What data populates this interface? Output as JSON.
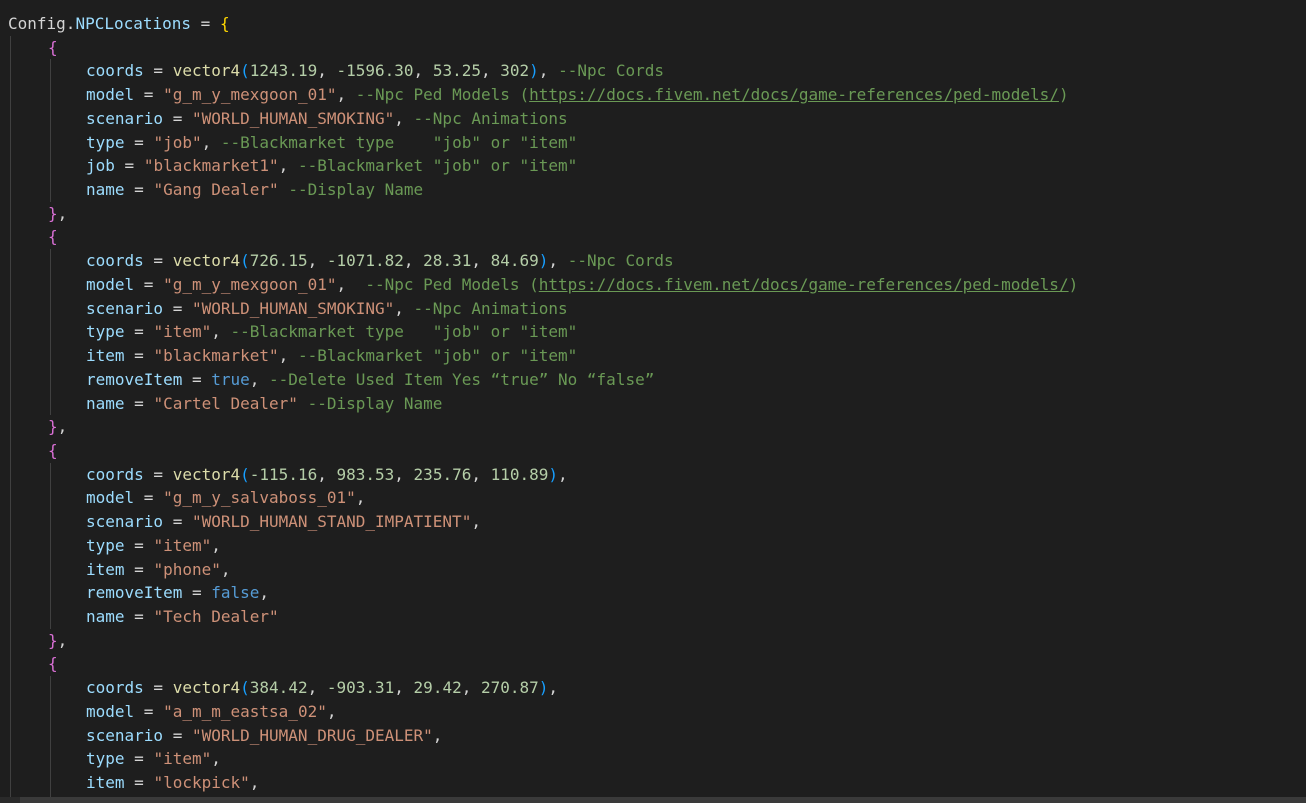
{
  "editor": {
    "lines": [
      [
        [
          "Config.",
          "plain"
        ],
        [
          "NPCLocations",
          "var"
        ],
        [
          " = ",
          "plain"
        ],
        [
          "{",
          "b1"
        ]
      ],
      [
        [
          "{",
          "b2"
        ]
      ],
      [
        [
          "coords",
          "var"
        ],
        [
          " = ",
          "plain"
        ],
        [
          "vector4",
          "func"
        ],
        [
          "(",
          "b3"
        ],
        [
          "1243.19",
          "num"
        ],
        [
          ", ",
          "plain"
        ],
        [
          "-1596.30",
          "num"
        ],
        [
          ", ",
          "plain"
        ],
        [
          "53.25",
          "num"
        ],
        [
          ", ",
          "plain"
        ],
        [
          "302",
          "num"
        ],
        [
          ")",
          "b3"
        ],
        [
          ", ",
          "plain"
        ],
        [
          "--Npc Cords",
          "com"
        ]
      ],
      [
        [
          "model",
          "var"
        ],
        [
          " = ",
          "plain"
        ],
        [
          "\"g_m_y_mexgoon_01\"",
          "str"
        ],
        [
          ", ",
          "plain"
        ],
        [
          "--Npc Ped Models (",
          "com"
        ],
        [
          "https://docs.fivem.net/docs/game-references/ped-models/",
          "link"
        ],
        [
          ")",
          "com"
        ]
      ],
      [
        [
          "scenario",
          "var"
        ],
        [
          " = ",
          "plain"
        ],
        [
          "\"WORLD_HUMAN_SMOKING\"",
          "str"
        ],
        [
          ", ",
          "plain"
        ],
        [
          "--Npc Animations",
          "com"
        ]
      ],
      [
        [
          "type",
          "var"
        ],
        [
          " = ",
          "plain"
        ],
        [
          "\"job\"",
          "str"
        ],
        [
          ", ",
          "plain"
        ],
        [
          "--Blackmarket type    \"job\" or \"item\"",
          "com"
        ]
      ],
      [
        [
          "job",
          "var"
        ],
        [
          " = ",
          "plain"
        ],
        [
          "\"blackmarket1\"",
          "str"
        ],
        [
          ", ",
          "plain"
        ],
        [
          "--Blackmarket \"job\" or \"item\"",
          "com"
        ]
      ],
      [
        [
          "name",
          "var"
        ],
        [
          " = ",
          "plain"
        ],
        [
          "\"Gang Dealer\"",
          "str"
        ],
        [
          " ",
          "plain"
        ],
        [
          "--Display Name",
          "com"
        ]
      ],
      [
        [
          "}",
          "b2"
        ],
        [
          ",",
          "plain"
        ]
      ],
      [
        [
          "{",
          "b2"
        ]
      ],
      [
        [
          "coords",
          "var"
        ],
        [
          " = ",
          "plain"
        ],
        [
          "vector4",
          "func"
        ],
        [
          "(",
          "b3"
        ],
        [
          "726.15",
          "num"
        ],
        [
          ", ",
          "plain"
        ],
        [
          "-1071.82",
          "num"
        ],
        [
          ", ",
          "plain"
        ],
        [
          "28.31",
          "num"
        ],
        [
          ", ",
          "plain"
        ],
        [
          "84.69",
          "num"
        ],
        [
          ")",
          "b3"
        ],
        [
          ", ",
          "plain"
        ],
        [
          "--Npc Cords",
          "com"
        ]
      ],
      [
        [
          "model",
          "var"
        ],
        [
          " = ",
          "plain"
        ],
        [
          "\"g_m_y_mexgoon_01\"",
          "str"
        ],
        [
          ",  ",
          "plain"
        ],
        [
          "--Npc Ped Models (",
          "com"
        ],
        [
          "https://docs.fivem.net/docs/game-references/ped-models/",
          "link"
        ],
        [
          ")",
          "com"
        ]
      ],
      [
        [
          "scenario",
          "var"
        ],
        [
          " = ",
          "plain"
        ],
        [
          "\"WORLD_HUMAN_SMOKING\"",
          "str"
        ],
        [
          ", ",
          "plain"
        ],
        [
          "--Npc Animations",
          "com"
        ]
      ],
      [
        [
          "type",
          "var"
        ],
        [
          " = ",
          "plain"
        ],
        [
          "\"item\"",
          "str"
        ],
        [
          ", ",
          "plain"
        ],
        [
          "--Blackmarket type   \"job\" or \"item\"",
          "com"
        ]
      ],
      [
        [
          "item",
          "var"
        ],
        [
          " = ",
          "plain"
        ],
        [
          "\"blackmarket\"",
          "str"
        ],
        [
          ", ",
          "plain"
        ],
        [
          "--Blackmarket \"job\" or \"item\"",
          "com"
        ]
      ],
      [
        [
          "removeItem",
          "var"
        ],
        [
          " = ",
          "plain"
        ],
        [
          "true",
          "kw"
        ],
        [
          ", ",
          "plain"
        ],
        [
          "--Delete Used Item Yes “true” No “false”",
          "com"
        ]
      ],
      [
        [
          "name",
          "var"
        ],
        [
          " = ",
          "plain"
        ],
        [
          "\"Cartel Dealer\"",
          "str"
        ],
        [
          " ",
          "plain"
        ],
        [
          "--Display Name",
          "com"
        ]
      ],
      [
        [
          "}",
          "b2"
        ],
        [
          ",",
          "plain"
        ]
      ],
      [
        [
          "{",
          "b2"
        ]
      ],
      [
        [
          "coords",
          "var"
        ],
        [
          " = ",
          "plain"
        ],
        [
          "vector4",
          "func"
        ],
        [
          "(",
          "b3"
        ],
        [
          "-115.16",
          "num"
        ],
        [
          ", ",
          "plain"
        ],
        [
          "983.53",
          "num"
        ],
        [
          ", ",
          "plain"
        ],
        [
          "235.76",
          "num"
        ],
        [
          ", ",
          "plain"
        ],
        [
          "110.89",
          "num"
        ],
        [
          ")",
          "b3"
        ],
        [
          ",",
          "plain"
        ]
      ],
      [
        [
          "model",
          "var"
        ],
        [
          " = ",
          "plain"
        ],
        [
          "\"g_m_y_salvaboss_01\"",
          "str"
        ],
        [
          ",",
          "plain"
        ]
      ],
      [
        [
          "scenario",
          "var"
        ],
        [
          " = ",
          "plain"
        ],
        [
          "\"WORLD_HUMAN_STAND_IMPATIENT\"",
          "str"
        ],
        [
          ",",
          "plain"
        ]
      ],
      [
        [
          "type",
          "var"
        ],
        [
          " = ",
          "plain"
        ],
        [
          "\"item\"",
          "str"
        ],
        [
          ",",
          "plain"
        ]
      ],
      [
        [
          "item",
          "var"
        ],
        [
          " = ",
          "plain"
        ],
        [
          "\"phone\"",
          "str"
        ],
        [
          ",",
          "plain"
        ]
      ],
      [
        [
          "removeItem",
          "var"
        ],
        [
          " = ",
          "plain"
        ],
        [
          "false",
          "kw"
        ],
        [
          ",",
          "plain"
        ]
      ],
      [
        [
          "name",
          "var"
        ],
        [
          " = ",
          "plain"
        ],
        [
          "\"Tech Dealer\"",
          "str"
        ]
      ],
      [
        [
          "}",
          "b2"
        ],
        [
          ",",
          "plain"
        ]
      ],
      [
        [
          "{",
          "b2"
        ]
      ],
      [
        [
          "coords",
          "var"
        ],
        [
          " = ",
          "plain"
        ],
        [
          "vector4",
          "func"
        ],
        [
          "(",
          "b3"
        ],
        [
          "384.42",
          "num"
        ],
        [
          ", ",
          "plain"
        ],
        [
          "-903.31",
          "num"
        ],
        [
          ", ",
          "plain"
        ],
        [
          "29.42",
          "num"
        ],
        [
          ", ",
          "plain"
        ],
        [
          "270.87",
          "num"
        ],
        [
          ")",
          "b3"
        ],
        [
          ",",
          "plain"
        ]
      ],
      [
        [
          "model",
          "var"
        ],
        [
          " = ",
          "plain"
        ],
        [
          "\"a_m_m_eastsa_02\"",
          "str"
        ],
        [
          ",",
          "plain"
        ]
      ],
      [
        [
          "scenario",
          "var"
        ],
        [
          " = ",
          "plain"
        ],
        [
          "\"WORLD_HUMAN_DRUG_DEALER\"",
          "str"
        ],
        [
          ",",
          "plain"
        ]
      ],
      [
        [
          "type",
          "var"
        ],
        [
          " = ",
          "plain"
        ],
        [
          "\"item\"",
          "str"
        ],
        [
          ",",
          "plain"
        ]
      ],
      [
        [
          "item",
          "var"
        ],
        [
          " = ",
          "plain"
        ],
        [
          "\"lockpick\"",
          "str"
        ],
        [
          ",",
          "plain"
        ]
      ]
    ]
  }
}
